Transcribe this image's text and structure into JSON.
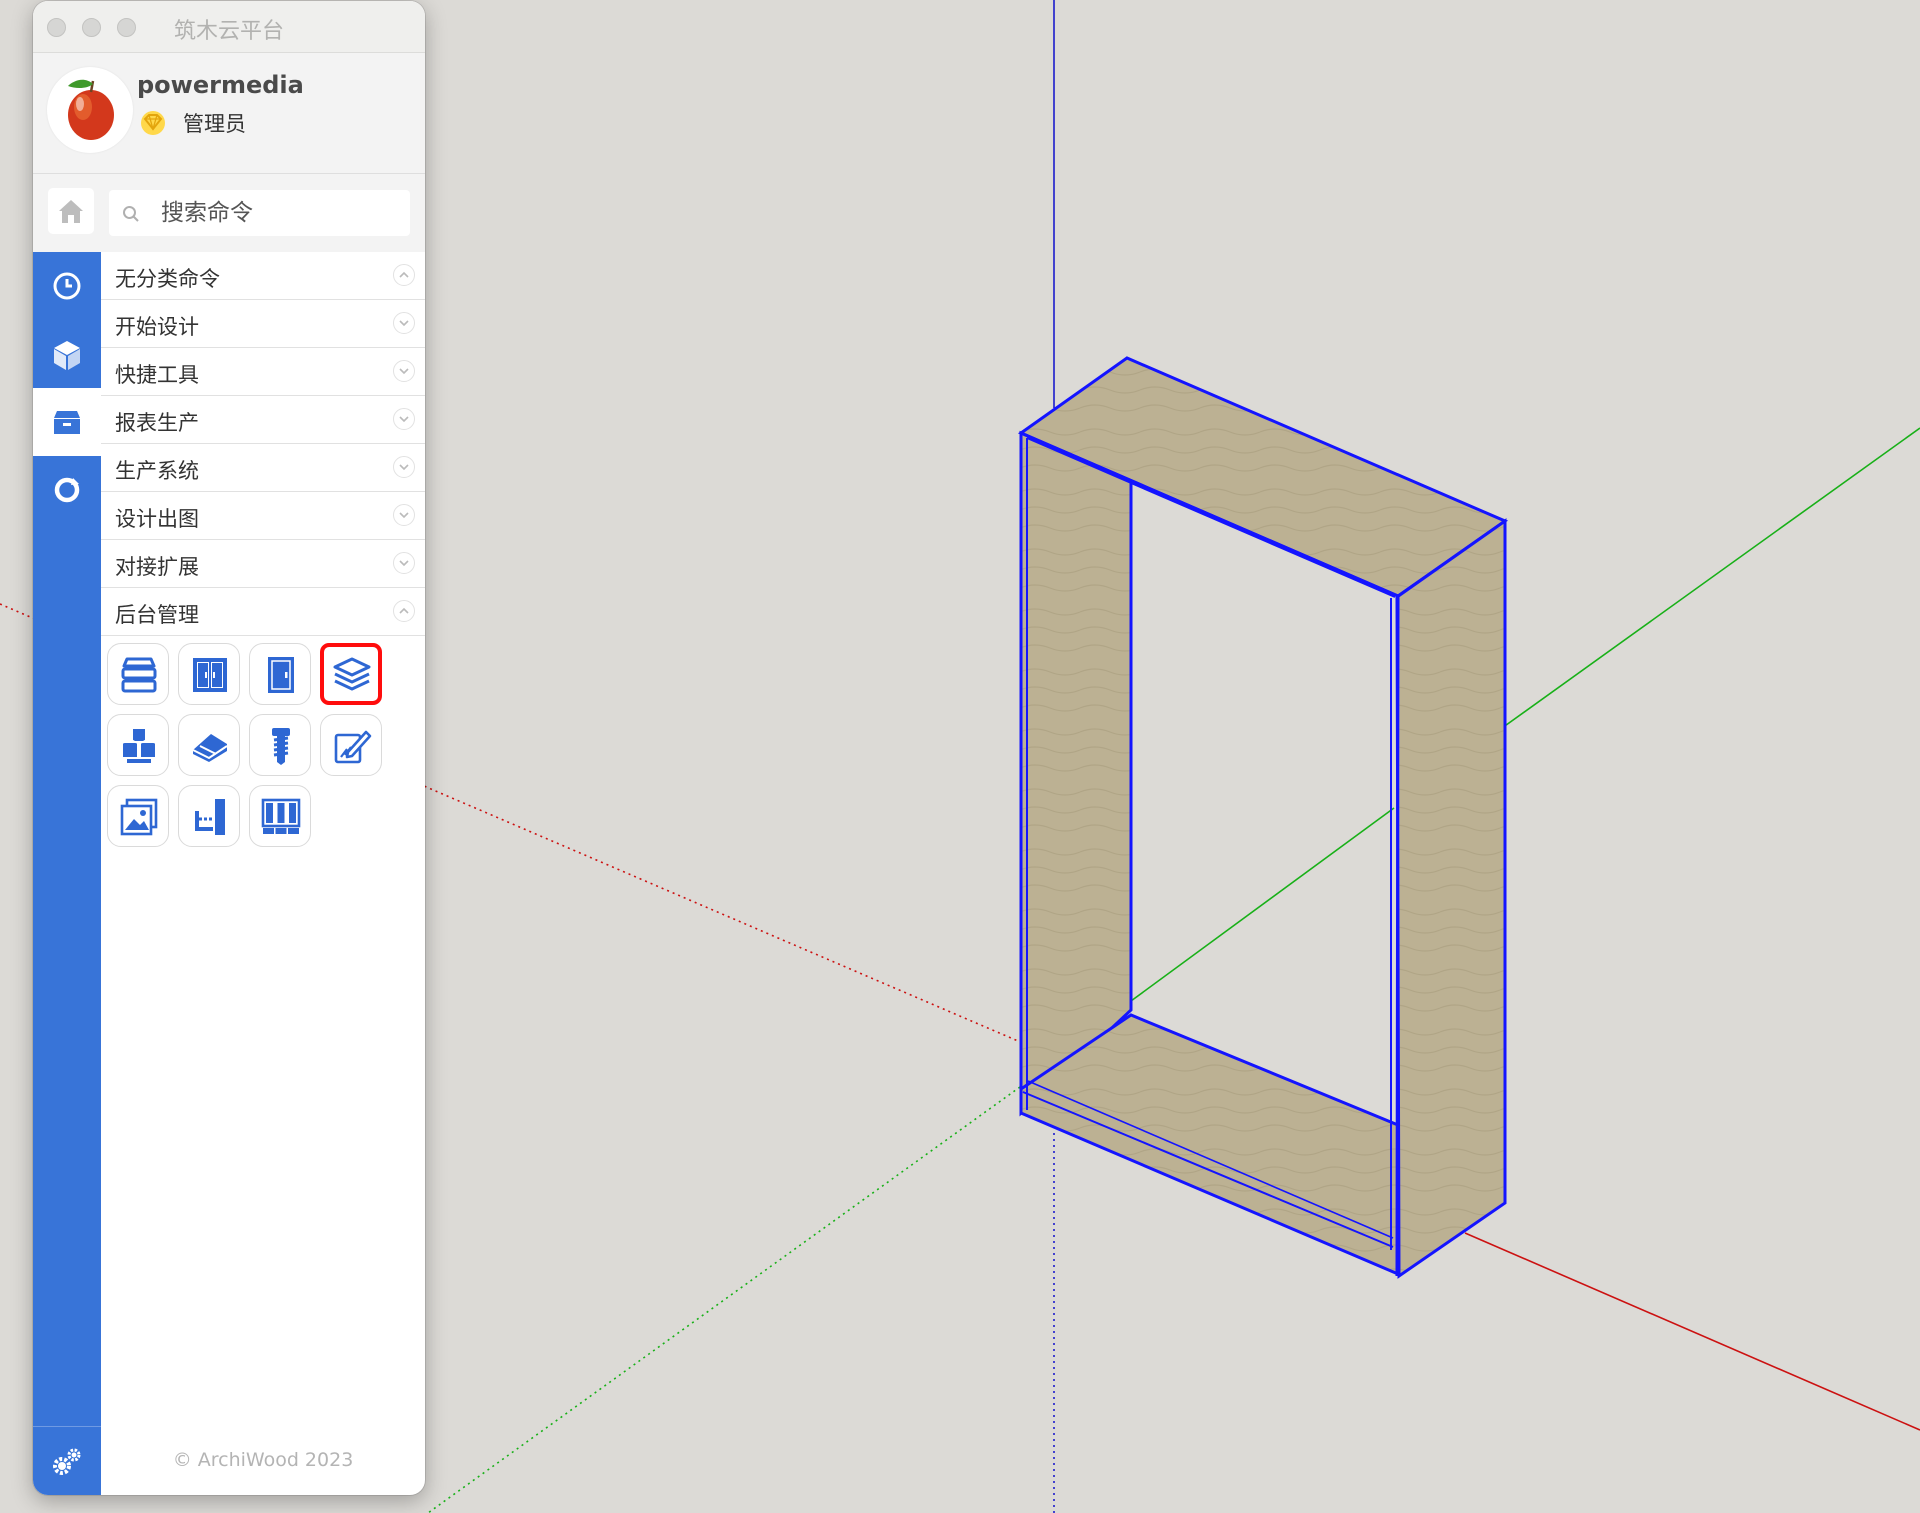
{
  "window": {
    "title": "筑木云平台"
  },
  "user": {
    "name": "powermedia",
    "role": "管理员"
  },
  "search": {
    "placeholder": "搜索命令"
  },
  "sidebar": {
    "items": [
      {
        "icon": "clock-icon"
      },
      {
        "icon": "cube-icon"
      },
      {
        "icon": "box-icon",
        "active": true
      },
      {
        "icon": "sync-icon"
      }
    ],
    "bottom_icon": "settings-gears-icon"
  },
  "categories": [
    {
      "label": "无分类命令",
      "expanded": true
    },
    {
      "label": "开始设计",
      "expanded": false
    },
    {
      "label": "快捷工具",
      "expanded": false
    },
    {
      "label": "报表生产",
      "expanded": false
    },
    {
      "label": "生产系统",
      "expanded": false
    },
    {
      "label": "设计出图",
      "expanded": false
    },
    {
      "label": "对接扩展",
      "expanded": false
    },
    {
      "label": "后台管理",
      "expanded": true
    }
  ],
  "tools": [
    {
      "icon": "shelves-icon"
    },
    {
      "icon": "double-door-cabinet-icon"
    },
    {
      "icon": "door-icon"
    },
    {
      "icon": "layers-icon",
      "selected": true
    },
    {
      "icon": "blocks-icon"
    },
    {
      "icon": "eraser-icon"
    },
    {
      "icon": "screw-icon"
    },
    {
      "icon": "edit-link-icon"
    },
    {
      "icon": "image-icon"
    },
    {
      "icon": "connector-icon"
    },
    {
      "icon": "panels-icon"
    }
  ],
  "footer": {
    "text": "© ArchiWood 2023"
  },
  "colors": {
    "sidebar": "#3874d8",
    "icon_blue": "#2e67d3",
    "selected_outline": "#ff0d0d",
    "axis_red": "#cc1111",
    "axis_green": "#18b018",
    "axis_blue": "#1c1ccc",
    "wood": "#bcb193",
    "edge": "#1414ff",
    "background": "#dcdad6"
  }
}
